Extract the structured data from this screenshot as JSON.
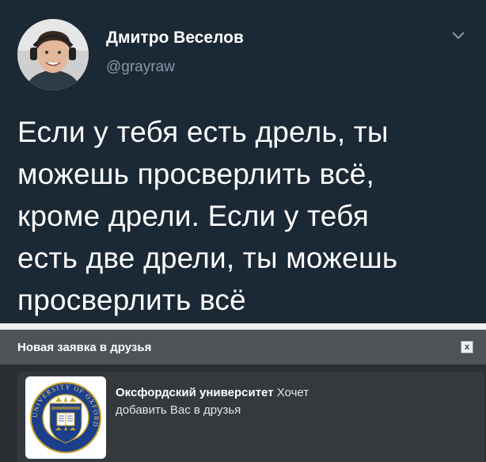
{
  "tweet": {
    "display_name": "Дмитро Веселов",
    "handle": "@grayraw",
    "lines": [
      "Если у тебя есть дрель, ты",
      "можешь просверлить всё,",
      "кроме дрели. Если у тебя",
      "есть две дрели, ты можешь",
      "просверлить всё"
    ]
  },
  "notification": {
    "title": "Новая заявка в друзья",
    "close_label": "x",
    "sender": "Оксфордский университет",
    "message_part1": " Хочет",
    "message_part2": "добавить Вас в друзья"
  },
  "crest": {
    "ring_text": "UNIVERSITY OF OXFORD"
  },
  "colors": {
    "tweet_bg": "#1b2836",
    "handle": "#8899a6",
    "notif_header": "#4e5358",
    "notif_card": "#35393d",
    "crest_blue": "#1c3f8c",
    "crest_gold": "#c9a227"
  }
}
